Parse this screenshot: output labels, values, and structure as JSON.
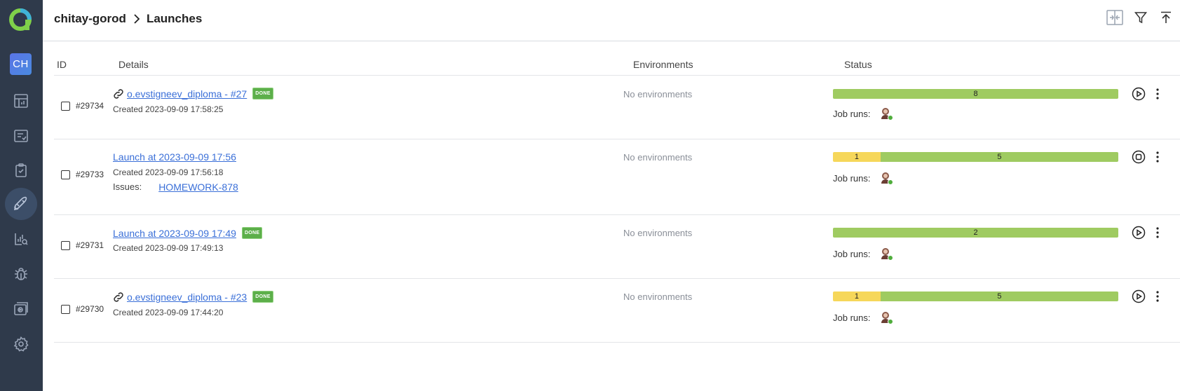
{
  "app": {
    "project_initials": "CH"
  },
  "breadcrumb": {
    "project": "chitay-gorod",
    "page": "Launches"
  },
  "table": {
    "headers": {
      "id": "ID",
      "details": "Details",
      "environments": "Environments",
      "status": "Status"
    },
    "rows": [
      {
        "id": "#29734",
        "title": "o.evstigneev_diploma - #27",
        "linked": true,
        "badge": "DONE",
        "created": "Created 2023-09-09 17:58:25",
        "environments": "No environments",
        "bar": [
          {
            "value": "8",
            "color": "green",
            "fraction": 1.0
          }
        ],
        "job_runs_label": "Job runs:",
        "action_icon": "play-circle-icon"
      },
      {
        "id": "#29733",
        "title": "Launch at 2023-09-09 17:56",
        "linked": false,
        "badge": "",
        "created": "Created 2023-09-09 17:56:18",
        "issues_label": "Issues:",
        "issue_key": "HOMEWORK-878",
        "environments": "No environments",
        "bar": [
          {
            "value": "1",
            "color": "yellow",
            "fraction": 0.1667
          },
          {
            "value": "5",
            "color": "green",
            "fraction": 0.8333
          }
        ],
        "job_runs_label": "Job runs:",
        "action_icon": "stop-circle-icon"
      },
      {
        "id": "#29731",
        "title": "Launch at 2023-09-09 17:49",
        "linked": false,
        "badge": "DONE",
        "created": "Created 2023-09-09 17:49:13",
        "environments": "No environments",
        "bar": [
          {
            "value": "2",
            "color": "green",
            "fraction": 1.0
          }
        ],
        "job_runs_label": "Job runs:",
        "action_icon": "play-circle-icon"
      },
      {
        "id": "#29730",
        "title": "o.evstigneev_diploma - #23",
        "linked": true,
        "badge": "DONE",
        "created": "Created 2023-09-09 17:44:20",
        "environments": "No environments",
        "bar": [
          {
            "value": "1",
            "color": "yellow",
            "fraction": 0.1667
          },
          {
            "value": "5",
            "color": "green",
            "fraction": 0.8333
          }
        ],
        "job_runs_label": "Job runs:",
        "action_icon": "play-circle-icon"
      }
    ]
  },
  "colors": {
    "sidebar": "#2f3a4b",
    "link": "#3a6fd8",
    "passed": "#9fcb61",
    "broken": "#f6d75a",
    "done_badge": "#5caf4a"
  }
}
